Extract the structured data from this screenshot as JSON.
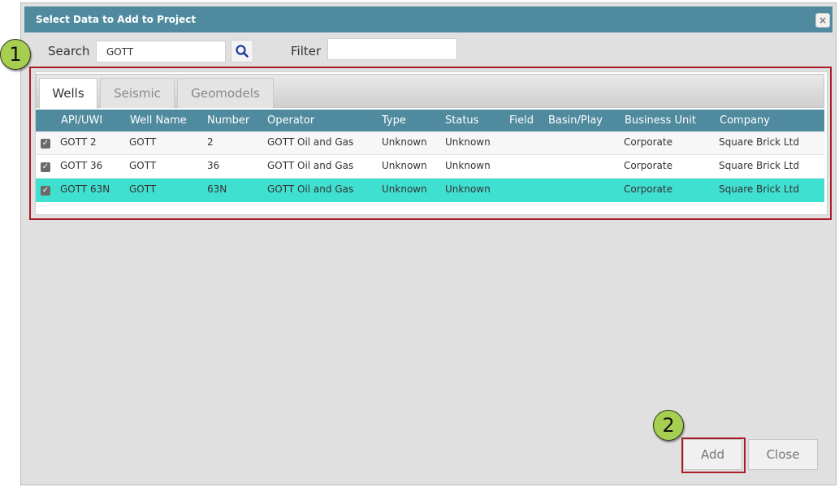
{
  "dialog": {
    "title": "Select Data to Add to Project",
    "close_glyph": "×"
  },
  "search": {
    "label": "Search",
    "value": "GOTT",
    "button_icon": "magnifier-icon"
  },
  "filter": {
    "label": "Filter",
    "value": ""
  },
  "callouts": {
    "one": "1",
    "two": "2"
  },
  "tabs": [
    {
      "label": "Wells",
      "active": true
    },
    {
      "label": "Seismic",
      "active": false
    },
    {
      "label": "Geomodels",
      "active": false
    }
  ],
  "columns": [
    "API/UWI",
    "Well Name",
    "Number",
    "Operator",
    "Type",
    "Status",
    "Field",
    "Basin/Play",
    "Business Unit",
    "Company"
  ],
  "rows": [
    {
      "checked": true,
      "api": "GOTT 2",
      "well_name": "GOTT",
      "number": "2",
      "operator": "GOTT Oil and Gas",
      "type": "Unknown",
      "status": "Unknown",
      "field": "",
      "basin": "",
      "business_unit": "Corporate",
      "company": "Square Brick Ltd"
    },
    {
      "checked": true,
      "api": "GOTT 36",
      "well_name": "GOTT",
      "number": "36",
      "operator": "GOTT Oil and Gas",
      "type": "Unknown",
      "status": "Unknown",
      "field": "",
      "basin": "",
      "business_unit": "Corporate",
      "company": "Square Brick Ltd"
    },
    {
      "checked": true,
      "api": "GOTT 63N",
      "well_name": "GOTT",
      "number": "63N",
      "operator": "GOTT Oil and Gas",
      "type": "Unknown",
      "status": "Unknown",
      "field": "",
      "basin": "",
      "business_unit": "Corporate",
      "company": "Square Brick Ltd"
    }
  ],
  "selected_row_color": "#40e0d0",
  "header_color": "#4f8a9e",
  "highlight_color": "#a81c25",
  "buttons": {
    "add": "Add",
    "close": "Close"
  }
}
